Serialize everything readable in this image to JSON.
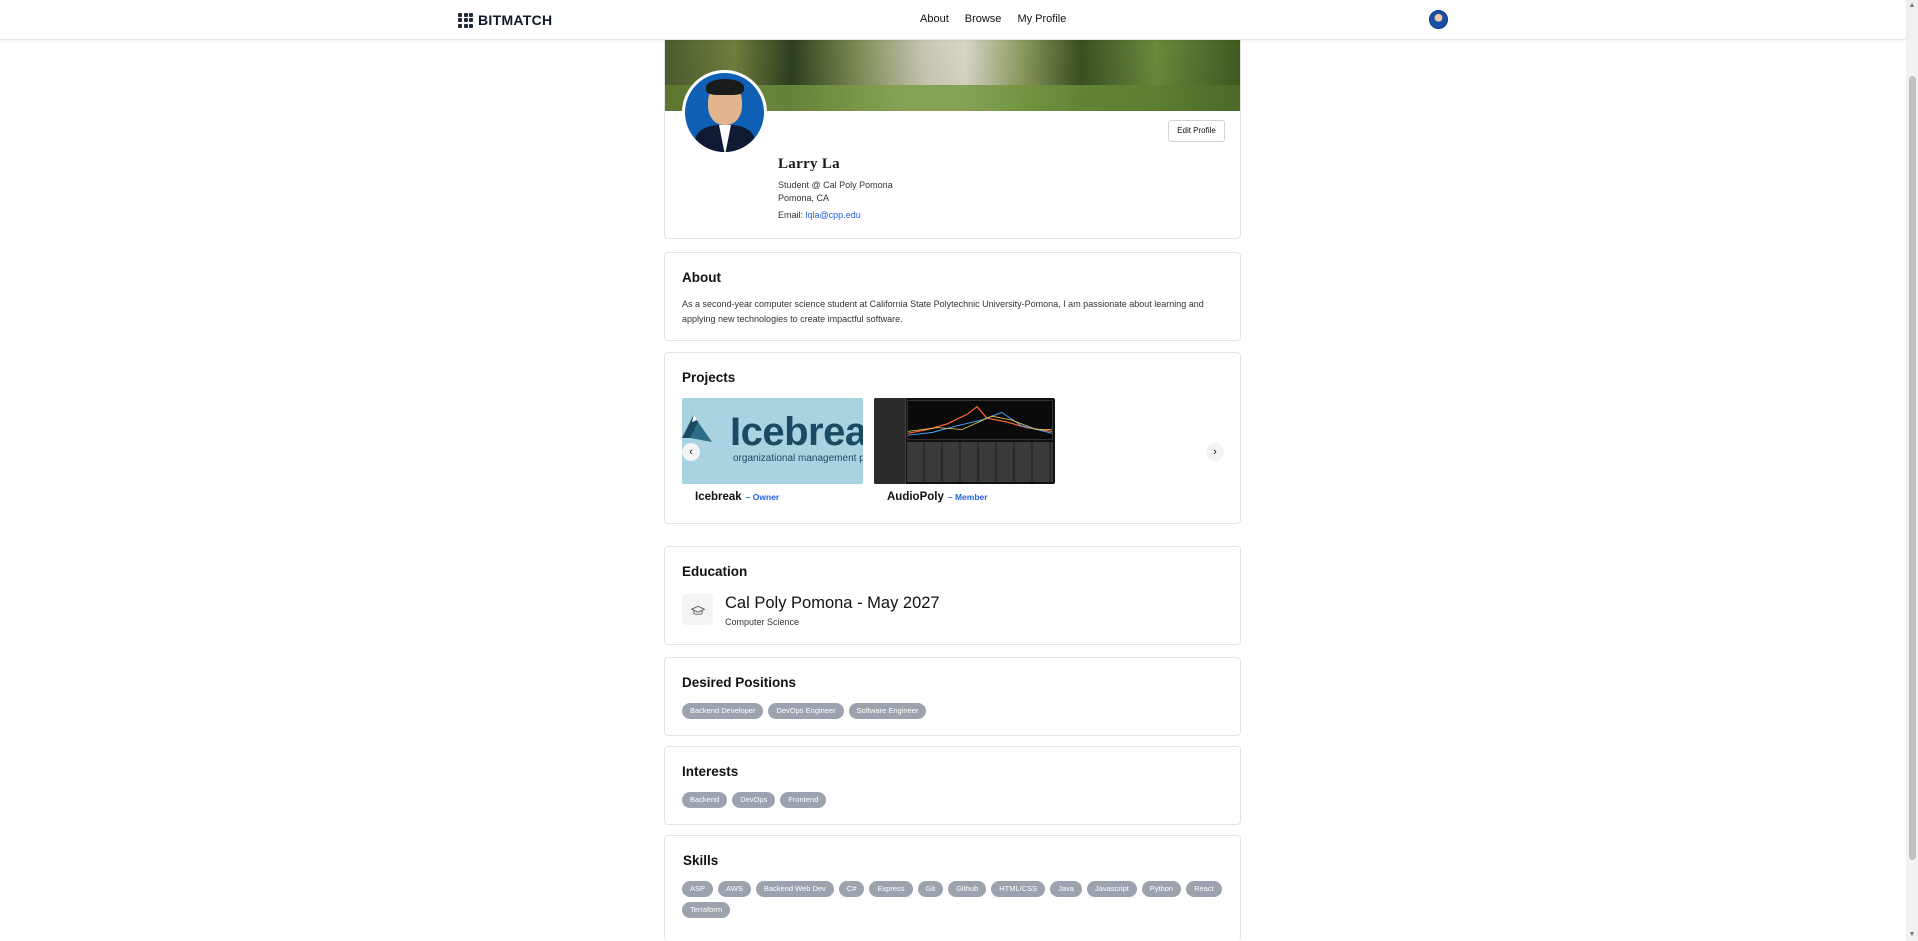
{
  "nav": {
    "brand": "BITMATCH",
    "links": [
      "About",
      "Browse",
      "My Profile"
    ]
  },
  "profile": {
    "name": "Larry La",
    "title": "Student @ Cal Poly Pomona",
    "location": "Pomona, CA",
    "email_label": "Email:",
    "email": "lqla@cpp.edu",
    "edit_label": "Edit Profile"
  },
  "about": {
    "heading": "About",
    "text": "As a second-year computer science student at California State Polytechnic University-Pomona, I am passionate about learning and applying new technologies to create impactful software."
  },
  "projects": {
    "heading": "Projects",
    "items": [
      {
        "name": "Icebreak",
        "role": "– Owner",
        "logo_word": "Icebrea",
        "logo_sub": "organizational management plat"
      },
      {
        "name": "AudioPoly",
        "role": "– Member"
      }
    ]
  },
  "education": {
    "heading": "Education",
    "school": "Cal Poly Pomona - May 2027",
    "major": "Computer Science",
    "icon": "graduation-cap-icon"
  },
  "desired_positions": {
    "heading": "Desired Positions",
    "items": [
      "Backend Developer",
      "DevOps Engineer",
      "Software Engineer"
    ]
  },
  "interests": {
    "heading": "Interests",
    "items": [
      "Backend",
      "DevOps",
      "Frontend"
    ]
  },
  "skills": {
    "heading": "Skills",
    "items": [
      "ASP",
      "AWS",
      "Backend Web Dev",
      "C#",
      "Express",
      "Git",
      "Github",
      "HTML/CSS",
      "Java",
      "Javascript",
      "Python",
      "React",
      "Terraform"
    ]
  },
  "colors": {
    "chip": "#9ca3af",
    "link": "#2563eb"
  }
}
